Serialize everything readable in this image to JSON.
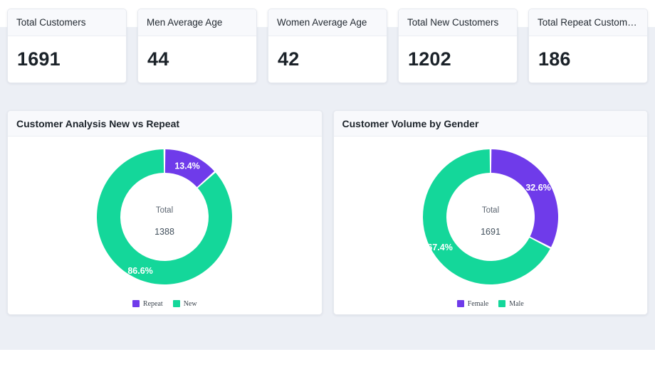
{
  "theme": {
    "page_background": "#ffffff",
    "canvas_background": "#eceff5",
    "card_background": "#ffffff",
    "card_header_background": "#f8f9fc",
    "purple": "#6f3bea",
    "green": "#14d79a",
    "text_dark": "#1b2229"
  },
  "kpis": [
    {
      "label": "Total Customers",
      "value": "1691"
    },
    {
      "label": "Men Average Age",
      "value": "44"
    },
    {
      "label": "Women Average Age",
      "value": "42"
    },
    {
      "label": "Total New Customers",
      "value": "1202"
    },
    {
      "label": "Total Repeat Customers",
      "value": "186"
    }
  ],
  "charts": [
    {
      "title": "Customer Analysis New vs Repeat",
      "center_label": "Total",
      "center_value": "1388",
      "legend": [
        {
          "label": "Repeat",
          "color": "#6f3bea"
        },
        {
          "label": "New",
          "color": "#14d79a"
        }
      ],
      "slices": [
        {
          "label": "Repeat",
          "percent_text": "13.4%",
          "percent": 13.4,
          "color": "#6f3bea"
        },
        {
          "label": "New",
          "percent_text": "86.6%",
          "percent": 86.6,
          "color": "#14d79a"
        }
      ]
    },
    {
      "title": "Customer Volume by Gender",
      "center_label": "Total",
      "center_value": "1691",
      "legend": [
        {
          "label": "Female",
          "color": "#6f3bea"
        },
        {
          "label": "Male",
          "color": "#14d79a"
        }
      ],
      "slices": [
        {
          "label": "Female",
          "percent_text": "32.6%",
          "percent": 32.6,
          "color": "#6f3bea"
        },
        {
          "label": "Male",
          "percent_text": "67.4%",
          "percent": 67.4,
          "color": "#14d79a"
        }
      ]
    }
  ],
  "chart_data": [
    {
      "type": "pie",
      "title": "Customer Analysis New vs Repeat",
      "variant": "donut",
      "categories": [
        "Repeat",
        "New"
      ],
      "values": [
        13.4,
        86.6
      ],
      "value_unit": "percent",
      "counts": [
        186,
        1202
      ],
      "total_label": "Total",
      "total": 1388,
      "colors": [
        "#6f3bea",
        "#14d79a"
      ],
      "legend_position": "bottom",
      "start_angle_deg": 0,
      "direction": "clockwise",
      "data_labels": [
        "13.4%",
        "86.6%"
      ]
    },
    {
      "type": "pie",
      "title": "Customer Volume by Gender",
      "variant": "donut",
      "categories": [
        "Female",
        "Male"
      ],
      "values": [
        32.6,
        67.4
      ],
      "value_unit": "percent",
      "total_label": "Total",
      "total": 1691,
      "colors": [
        "#6f3bea",
        "#14d79a"
      ],
      "legend_position": "bottom",
      "start_angle_deg": 0,
      "direction": "clockwise",
      "data_labels": [
        "32.6%",
        "67.4%"
      ]
    }
  ]
}
